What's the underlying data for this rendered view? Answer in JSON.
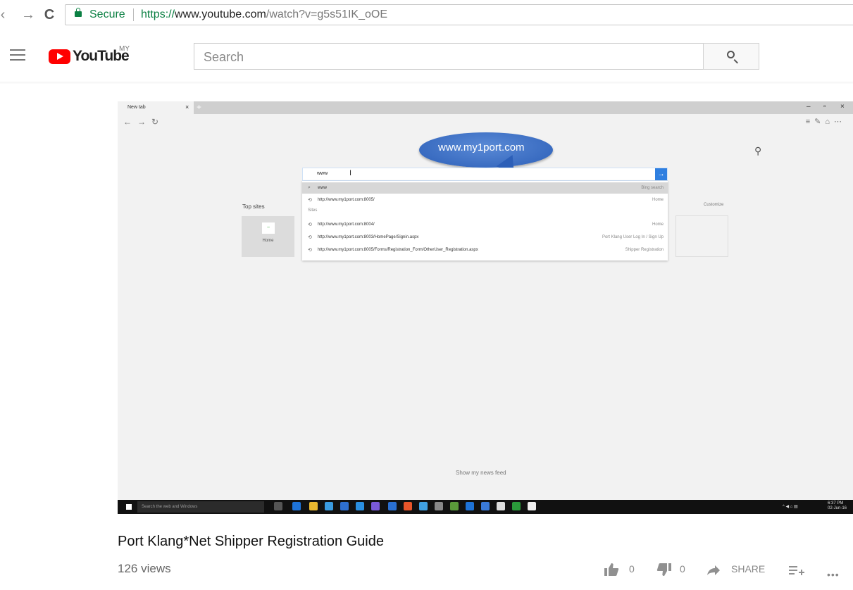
{
  "browser": {
    "secure_label": "Secure",
    "url_scheme": "https://",
    "url_host": "www.youtube.com",
    "url_path": "/watch?v=g5s51IK_oOE"
  },
  "youtube": {
    "logo_text": "YouTube",
    "country": "MY",
    "search_placeholder": "Search"
  },
  "video_frame": {
    "tab_label": "New tab",
    "bubble_text": "www.my1port.com",
    "search_query": "www",
    "suggestions": [
      {
        "icon": "search-icon",
        "text": "www",
        "right": "Bing search"
      },
      {
        "icon": "history-icon",
        "text": "http://www.my1port.com:8005/",
        "right": "Home"
      },
      {
        "icon": "",
        "text": "Sites",
        "right": ""
      },
      {
        "icon": "history-icon",
        "text": "http://www.my1port.com:8004/",
        "right": "Home"
      },
      {
        "icon": "history-icon",
        "text": "http://www.my1port.com:8003/HomePage/Signin.aspx",
        "right": "Port Klang User Log In / Sign Up"
      },
      {
        "icon": "history-icon",
        "text": "http://www.my1port.com:8005/Forms/Registration_Form/OtherUser_Registration.aspx",
        "right": "Shipper Registration"
      }
    ],
    "top_sites_label": "Top sites",
    "tile_label": "Home",
    "customize_label": "Customize",
    "news_feed_label": "Show my news feed",
    "taskbar_search": "Search the web and Windows",
    "clock_time": "6:37 PM",
    "clock_date": "02-Jun-16"
  },
  "video": {
    "title": "Port Klang*Net Shipper Registration Guide",
    "views": "126 views",
    "likes": "0",
    "dislikes": "0",
    "share_label": "SHARE"
  }
}
